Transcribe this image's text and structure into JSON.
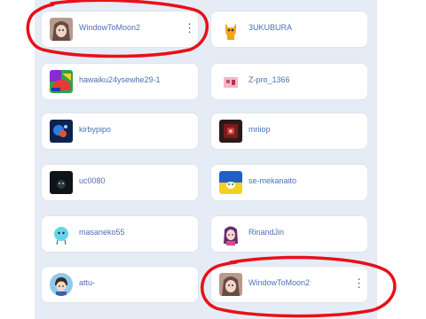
{
  "users": [
    {
      "name": "WindowToMoon2",
      "icon": "anime-portrait-avatar",
      "menu": "⋮"
    },
    {
      "name": "3UKUBURA",
      "icon": "scratch-cat-avatar"
    },
    {
      "name": "hawaiku24ysewhe29-1",
      "icon": "colorful-abstract-avatar"
    },
    {
      "name": "Z-pro_1366",
      "icon": "pink-sketch-avatar"
    },
    {
      "name": "kirbypipo",
      "icon": "dark-blue-sparkle-avatar"
    },
    {
      "name": "mriiop",
      "icon": "dark-red-avatar"
    },
    {
      "name": "uc0080",
      "icon": "dark-avatar"
    },
    {
      "name": "se-mekanaito",
      "icon": "ukraine-flag-avatar"
    },
    {
      "name": "masaneko55",
      "icon": "blue-blob-avatar"
    },
    {
      "name": "RinandJin",
      "icon": "purple-hair-girl-avatar"
    },
    {
      "name": "attu-",
      "icon": "boy-circle-avatar"
    },
    {
      "name": "WindowToMoon2",
      "icon": "anime-portrait-avatar",
      "menu": "⋮"
    }
  ],
  "annotation_color": "#e8101a"
}
